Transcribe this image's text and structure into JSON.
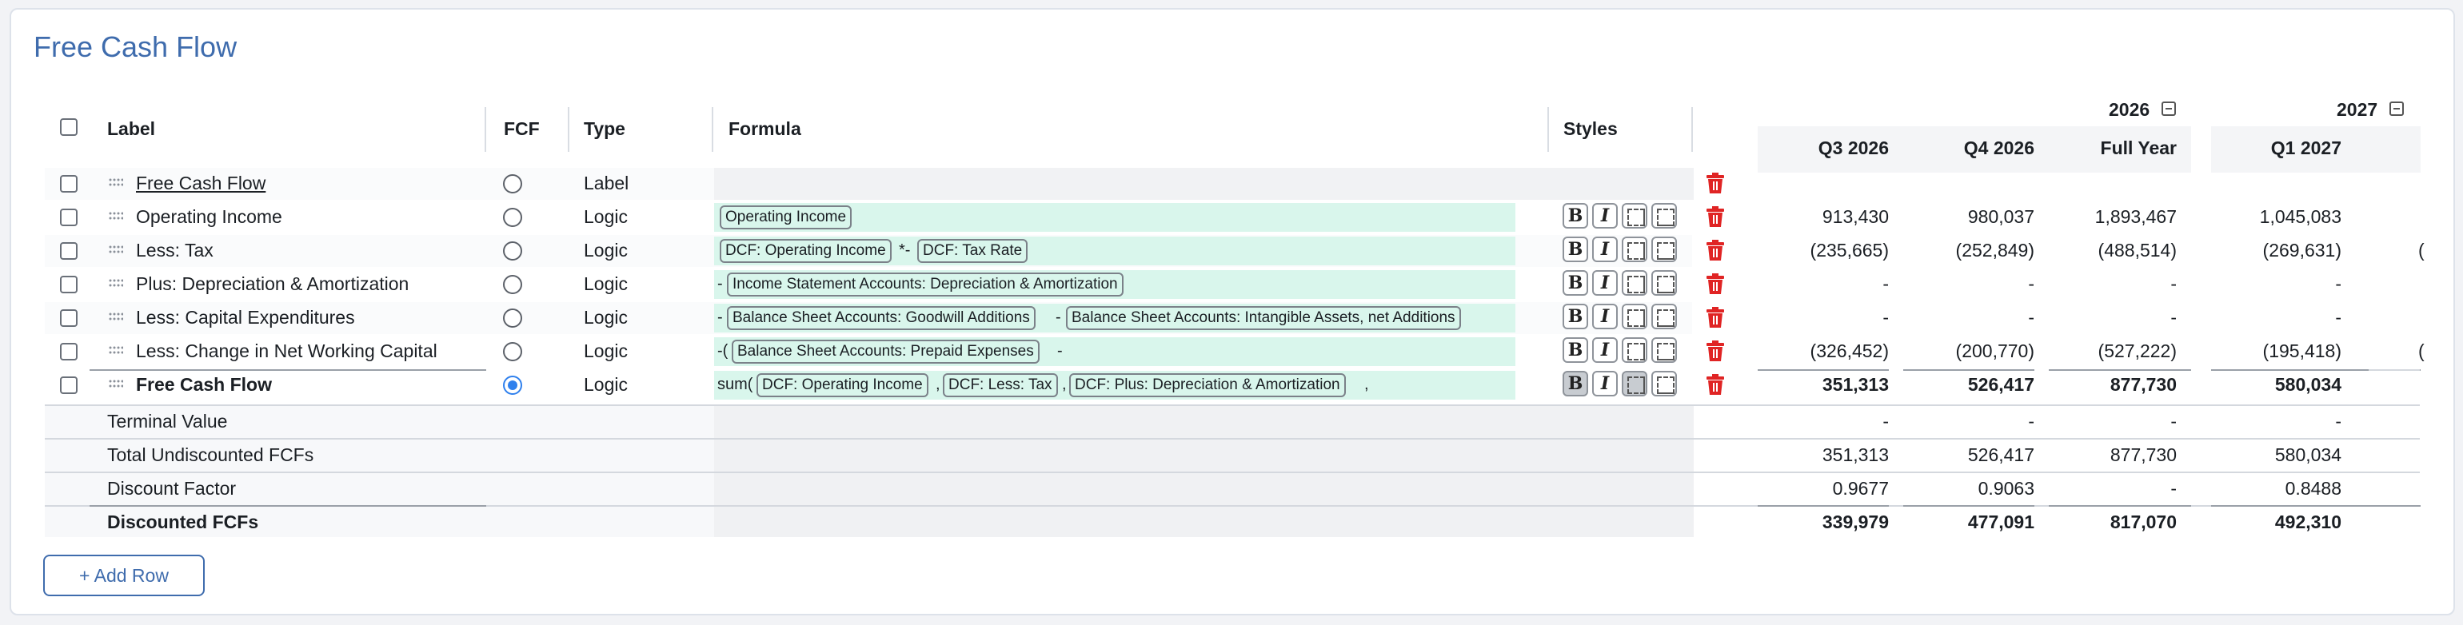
{
  "page": {
    "title": "Free Cash Flow"
  },
  "table": {
    "headers": {
      "label": "Label",
      "fcf": "FCF",
      "type": "Type",
      "formula": "Formula",
      "styles": "Styles"
    },
    "years": [
      {
        "label": "2026"
      },
      {
        "label": "2027"
      }
    ],
    "periods": [
      "Q3 2026",
      "Q4 2026",
      "Full Year",
      "Q1 2027"
    ],
    "rows": [
      {
        "label": "Free Cash Flow",
        "type": "Label",
        "fcf": false,
        "values": [
          "",
          "",
          "",
          ""
        ]
      },
      {
        "label": "Operating Income",
        "type": "Logic",
        "fcf": false,
        "values": [
          "913,430",
          "980,037",
          "1,893,467",
          "1,045,083"
        ]
      },
      {
        "label": "Less: Tax",
        "type": "Logic",
        "fcf": false,
        "values": [
          "(235,665)",
          "(252,849)",
          "(488,514)",
          "(269,631)"
        ]
      },
      {
        "label": "Plus: Depreciation & Amortization",
        "type": "Logic",
        "fcf": false,
        "values": [
          "-",
          "-",
          "-",
          "-"
        ]
      },
      {
        "label": "Less: Capital Expenditures",
        "type": "Logic",
        "fcf": false,
        "values": [
          "-",
          "-",
          "-",
          "-"
        ]
      },
      {
        "label": "Less: Change in Net Working Capital",
        "type": "Logic",
        "fcf": false,
        "values": [
          "(326,452)",
          "(200,770)",
          "(527,222)",
          "(195,418)"
        ]
      },
      {
        "label": "Free Cash Flow",
        "type": "Logic",
        "fcf": true,
        "values": [
          "351,313",
          "526,417",
          "877,730",
          "580,034"
        ]
      }
    ],
    "formulas": {
      "r1": {
        "chip1": "Operating Income"
      },
      "r2": {
        "chip1": "DCF: Operating Income",
        "op1": "*-",
        "chip2": "DCF: Tax Rate"
      },
      "r3": {
        "op1": "-",
        "chip1": "Income Statement Accounts: Depreciation & Amortization"
      },
      "r4": {
        "op1": "-",
        "chip1": "Balance Sheet Accounts: Goodwill Additions",
        "op2": "-",
        "chip2": "Balance Sheet Accounts: Intangible Assets, net Additions"
      },
      "r5": {
        "op1": "-(",
        "chip1": "Balance Sheet Accounts: Prepaid Expenses",
        "op2": "-"
      },
      "r6": {
        "op1": "sum(",
        "chip1": "DCF: Operating Income",
        "op2": ",",
        "chip2": "DCF: Less: Tax",
        "op3": ",",
        "chip3": "DCF: Plus: Depreciation & Amortization",
        "op4": ","
      }
    },
    "style_buttons": {
      "bold": "B",
      "italic": "I"
    },
    "summary": [
      {
        "label": "Terminal Value",
        "values": [
          "-",
          "-",
          "-",
          "-"
        ]
      },
      {
        "label": "Total Undiscounted FCFs",
        "values": [
          "351,313",
          "526,417",
          "877,730",
          "580,034"
        ]
      },
      {
        "label": "Discount Factor",
        "values": [
          "0.9677",
          "0.9063",
          "-",
          "0.8488"
        ]
      },
      {
        "label": "Discounted FCFs",
        "values": [
          "339,979",
          "477,091",
          "817,070",
          "492,310"
        ]
      }
    ]
  },
  "actions": {
    "add_row": "+ Add Row"
  },
  "colors": {
    "accent": "#3f6cad",
    "formula_bg": "#d9f6ec",
    "delete": "#e02424",
    "radio_on": "#2f80ed"
  },
  "icons": {
    "delete": "trash-icon",
    "drag": "drag-handle-icon",
    "collapse": "collapse-minus-icon"
  }
}
